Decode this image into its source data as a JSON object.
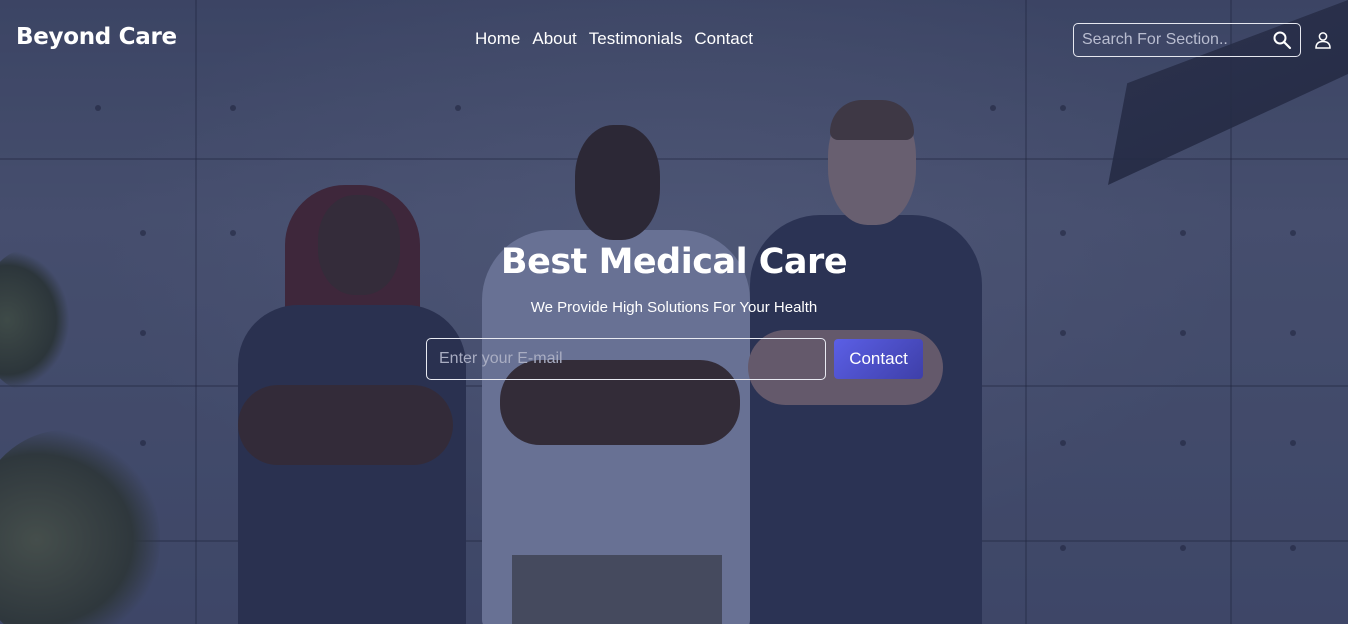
{
  "brand": {
    "name": "Beyond Care"
  },
  "nav": {
    "links": [
      {
        "label": "Home"
      },
      {
        "label": "About"
      },
      {
        "label": "Testimonials"
      },
      {
        "label": "Contact"
      }
    ]
  },
  "search": {
    "placeholder": "Search For Section..",
    "value": ""
  },
  "hero": {
    "title": "Best Medical Care",
    "subtitle": "We Provide High Solutions For Your Health",
    "email_placeholder": "Enter your E-mail",
    "email_value": "",
    "button_label": "Contact"
  },
  "icons": {
    "search": "search-icon",
    "user": "user-icon"
  },
  "colors": {
    "accent": "#5b5fe6",
    "accent_dark": "#3e3fa8",
    "overlay": "#2e3550"
  }
}
